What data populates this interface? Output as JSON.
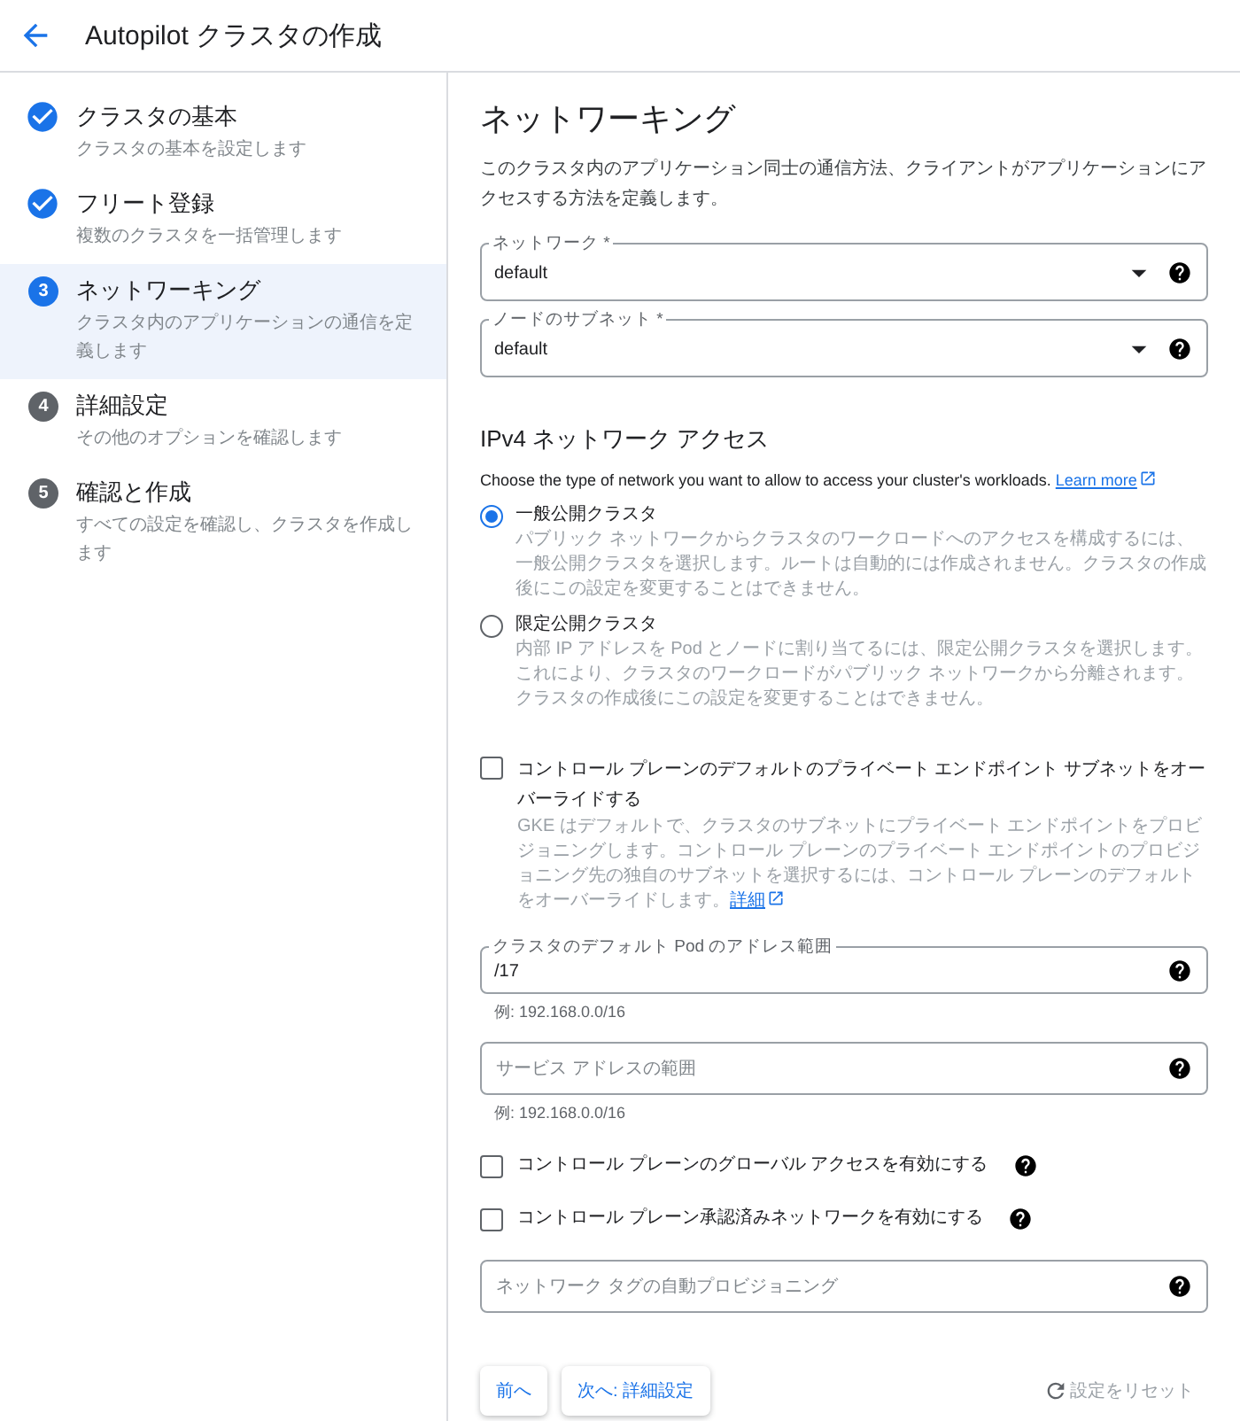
{
  "header": {
    "title": "Autopilot クラスタの作成"
  },
  "steps": [
    {
      "done": true,
      "selected": false,
      "title": "クラスタの基本",
      "subtitle": "クラスタの基本を設定します"
    },
    {
      "done": true,
      "selected": false,
      "title": "フリート登録",
      "subtitle": "複数のクラスタを一括管理します"
    },
    {
      "done": false,
      "selected": true,
      "number": "3",
      "title": "ネットワーキング",
      "subtitle": "クラスタ内のアプリケーションの通信を定義します"
    },
    {
      "done": false,
      "selected": false,
      "number": "4",
      "title": "詳細設定",
      "subtitle": "その他のオプションを確認します"
    },
    {
      "done": false,
      "selected": false,
      "number": "5",
      "title": "確認と作成",
      "subtitle": "すべての設定を確認し、クラスタを作成します"
    }
  ],
  "main": {
    "heading": "ネットワーキング",
    "description": "このクラスタ内のアプリケーション同士の通信方法、クライアントがアプリケーションにアクセスする方法を定義します。",
    "fields_top": [
      {
        "kind": "select",
        "label": "ネットワーク *",
        "value": "default"
      },
      {
        "kind": "select",
        "label": "ノードのサブネット *",
        "value": "default"
      }
    ],
    "access": {
      "heading": "IPv4 ネットワーク アクセス",
      "description": "Choose the type of network you want to allow to access your cluster's workloads.",
      "link": "Learn more",
      "options": [
        {
          "selected": true,
          "label": "一般公開クラスタ",
          "description": "パブリック ネットワークからクラスタのワークロードへのアクセスを構成するには、一般公開クラスタを選択します。ルートは自動的には作成されません。クラスタの作成後にこの設定を変更することはできません。"
        },
        {
          "selected": false,
          "label": "限定公開クラスタ",
          "description": "内部 IP アドレスを Pod とノードに割り当てるには、限定公開クラスタを選択します。これにより、クラスタのワークロードがパブリック ネットワークから分離されます。クラスタの作成後にこの設定を変更することはできません。"
        }
      ]
    },
    "override": {
      "checked": false,
      "label": "コントロール プレーンのデフォルトのプライベート エンドポイント サブネットをオーバーライドする",
      "description": "GKE はデフォルトで、クラスタのサブネットにプライベート エンドポイントをプロビジョニングします。コントロール プレーンのプライベート エンドポイントのプロビジョニング先の独自のサブネットを選択するには、コントロール プレーンのデフォルトをオーバーライドします。",
      "link": "詳細"
    },
    "fields_mid": [
      {
        "kind": "text",
        "label": "クラスタのデフォルト Pod のアドレス範囲",
        "value": "/17",
        "hint": "例: 192.168.0.0/16"
      },
      {
        "kind": "text",
        "placeholder": "サービス アドレスの範囲",
        "hint": "例: 192.168.0.0/16"
      }
    ],
    "checkboxes": [
      {
        "checked": false,
        "label": "コントロール プレーンのグローバル アクセスを有効にする"
      },
      {
        "checked": false,
        "label": "コントロール プレーン承認済みネットワークを有効にする"
      }
    ],
    "fields_bottom": [
      {
        "kind": "text",
        "placeholder": "ネットワーク タグの自動プロビジョニング"
      }
    ],
    "buttons": {
      "back": "前へ",
      "next": "次へ: 詳細設定",
      "reset": "設定をリセット"
    }
  }
}
